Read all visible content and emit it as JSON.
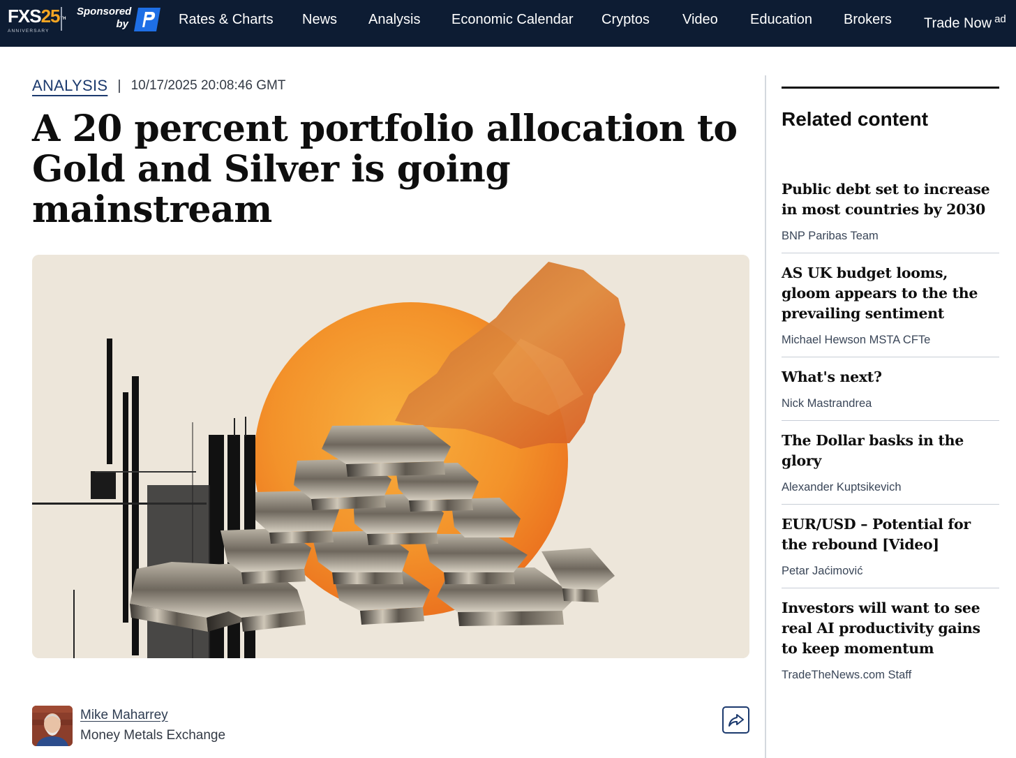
{
  "nav": {
    "logo_text": "FXS",
    "logo_num": "25",
    "logo_th": "TH",
    "logo_sub": "ANNIVERSARY",
    "sponsored_line1": "Sponsored",
    "sponsored_line2": "by",
    "items": [
      {
        "label": "Rates & Charts"
      },
      {
        "label": "News"
      },
      {
        "label": "Analysis"
      },
      {
        "label": "Economic Calendar"
      },
      {
        "label": "Cryptos"
      },
      {
        "label": "Video"
      },
      {
        "label": "Education"
      },
      {
        "label": "Brokers"
      },
      {
        "label": "Trade Now",
        "ad": "ad"
      }
    ],
    "bg_color": "#0d1c33"
  },
  "article": {
    "category": "ANALYSIS",
    "separator": "|",
    "date": "10/17/2025 20:08:46 GMT",
    "headline": "A 20 percent portfolio allocation to Gold and Silver is going mainstream",
    "hero_image": "silver-bars-pyramid-illustration",
    "author": {
      "name": "Mike Maharrey",
      "organization": "Money Metals Exchange"
    },
    "share_icon": "share-icon"
  },
  "sidebar": {
    "title": "Related content",
    "items": [
      {
        "headline": "Public debt set to increase in most countries by 2030",
        "author": "BNP Paribas Team"
      },
      {
        "headline": "AS UK budget looms, gloom appears to the the prevailing sentiment",
        "author": "Michael Hewson MSTA CFTe"
      },
      {
        "headline": "What's next?",
        "author": "Nick Mastrandrea"
      },
      {
        "headline": "The Dollar basks in the glory",
        "author": "Alexander Kuptsikevich"
      },
      {
        "headline": "EUR/USD – Potential for the rebound [Video]",
        "author": "Petar Jaćimović"
      },
      {
        "headline": "Investors will want to see real AI productivity gains to keep momentum",
        "author": "TradeTheNews.com Staff"
      }
    ]
  },
  "colors": {
    "accent": "#1c3a6e",
    "logo_accent": "#f5a623",
    "sun": "#f39a2c"
  }
}
